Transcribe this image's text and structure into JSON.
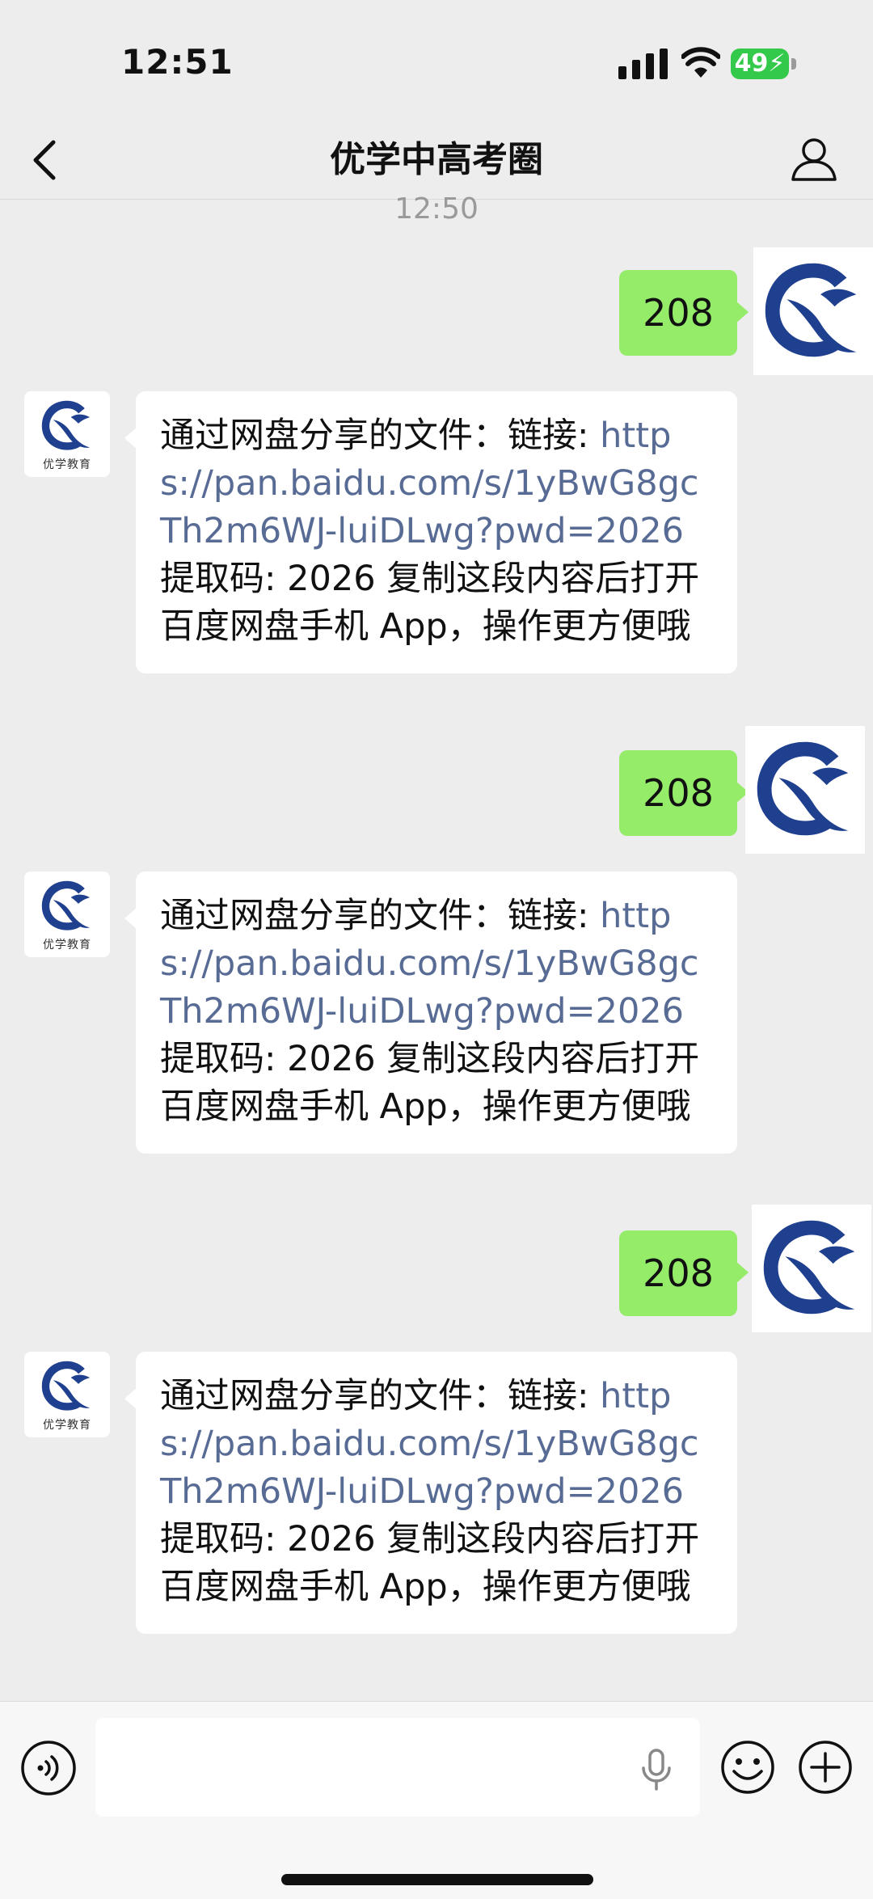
{
  "status_bar": {
    "time": "12:51",
    "battery": "49",
    "icons": [
      "signal-icon",
      "wifi-icon",
      "battery-icon"
    ]
  },
  "header": {
    "title": "优学中高考圈",
    "back_icon": "chevron-left-icon",
    "profile_icon": "person-icon"
  },
  "chat": {
    "timestamp": "12:50",
    "sender_caption": "优学教育",
    "messages": [
      {
        "direction": "out",
        "text": "208"
      },
      {
        "direction": "in",
        "text_before": "通过网盘分享的文件：链接: ",
        "link": "https://pan.baidu.com/s/1yBwG8gcTh2m6WJ-luiDLwg?pwd=2026",
        "text_after": " 提取码: 2026 复制这段内容后打开百度网盘手机 App，操作更方便哦"
      },
      {
        "direction": "out",
        "text": "208"
      },
      {
        "direction": "in",
        "text_before": "通过网盘分享的文件：链接: ",
        "link": "https://pan.baidu.com/s/1yBwG8gcTh2m6WJ-luiDLwg?pwd=2026",
        "text_after": " 提取码: 2026 复制这段内容后打开百度网盘手机 App，操作更方便哦"
      },
      {
        "direction": "out",
        "text": "208"
      },
      {
        "direction": "in",
        "text_before": "通过网盘分享的文件：链接: ",
        "link": "https://pan.baidu.com/s/1yBwG8gcTh2m6WJ-luiDLwg?pwd=2026",
        "text_after": " 提取码: 2026 复制这段内容后打开百度网盘手机 App，操作更方便哦"
      }
    ]
  },
  "input_bar": {
    "value": "",
    "icons": [
      "voice-icon",
      "microphone-icon",
      "emoji-icon",
      "plus-icon"
    ]
  },
  "colors": {
    "background": "#ededed",
    "outgoing_bubble": "#95ec69",
    "link": "#576b95",
    "logo_blue": "#1f3f8f",
    "battery": "#33c94a"
  }
}
